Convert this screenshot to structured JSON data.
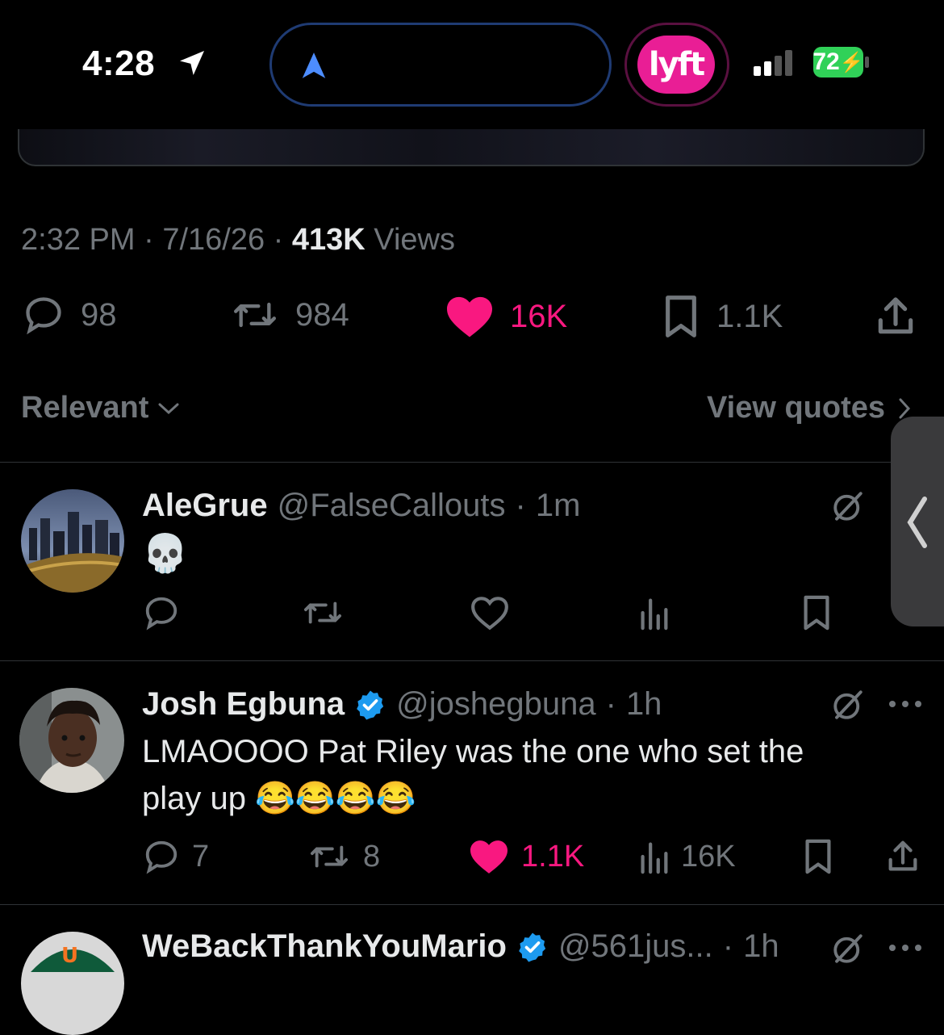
{
  "status_bar": {
    "time": "4:28",
    "battery": "72",
    "app_pill": "lyft"
  },
  "tweet": {
    "time": "2:32 PM",
    "date": "7/16/26",
    "views_count": "413K",
    "views_label": "Views",
    "stats": {
      "replies": "98",
      "reposts": "984",
      "likes": "16K",
      "bookmarks": "1.1K"
    }
  },
  "sort": {
    "label": "Relevant",
    "view_quotes": "View quotes"
  },
  "replies": [
    {
      "name": "AleGrue",
      "handle": "@FalseCallouts",
      "time": "1m",
      "text": "💀",
      "verified": false,
      "stats": {
        "replies": "",
        "reposts": "",
        "likes": "",
        "views": ""
      }
    },
    {
      "name": "Josh Egbuna",
      "handle": "@joshegbuna",
      "time": "1h",
      "verified": true,
      "text_line1": "LMAOOOO Pat Riley was the one who set the",
      "text_line2": "play up 😂😂😂😂",
      "stats": {
        "replies": "7",
        "reposts": "8",
        "likes": "1.1K",
        "views": "16K"
      }
    },
    {
      "name": "WeBackThankYouMario",
      "handle": "@561jus...",
      "time": "1h",
      "verified": true
    }
  ],
  "separator": "·",
  "colors": {
    "accent_pink": "#f91880",
    "verified_blue": "#1d9bf0",
    "lyft_pink": "#e91e95",
    "battery_green": "#30d158"
  }
}
